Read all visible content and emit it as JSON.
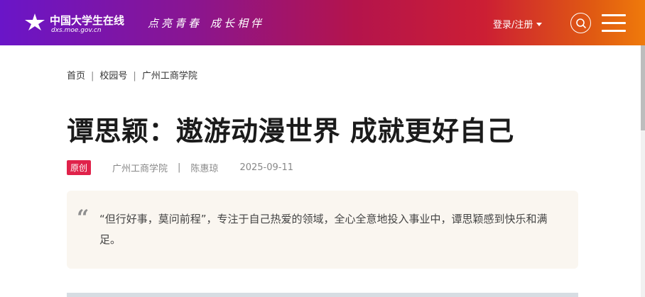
{
  "header": {
    "logo_text": "中国大学生在线",
    "logo_url": "dxs.moe.gov.cn",
    "slogan": [
      "点亮青春",
      "成长相伴"
    ],
    "login_label": "登录/注册",
    "colors": {
      "gradient_start": "#6a15c8",
      "gradient_mid": "#cc1e34",
      "gradient_end": "#ef7a0b"
    }
  },
  "breadcrumb": {
    "items": [
      "首页",
      "校园号",
      "广州工商学院"
    ],
    "separator": "|"
  },
  "article": {
    "title": "谭思颖：遨游动漫世界 成就更好自己",
    "badge": "原创",
    "source": "广州工商学院",
    "meta_separator": "|",
    "author": "陈惠琼",
    "date": "2025-09-11",
    "quote_mark": "“",
    "summary": "“但行好事，莫问前程”，专注于自己热爱的领域，全心全意地投入事业中，谭思颖感到快乐和满足。"
  },
  "icons": {
    "logo": "star-logo-icon",
    "search": "search-icon",
    "menu": "hamburger-menu-icon",
    "dropdown": "caret-down-icon"
  }
}
